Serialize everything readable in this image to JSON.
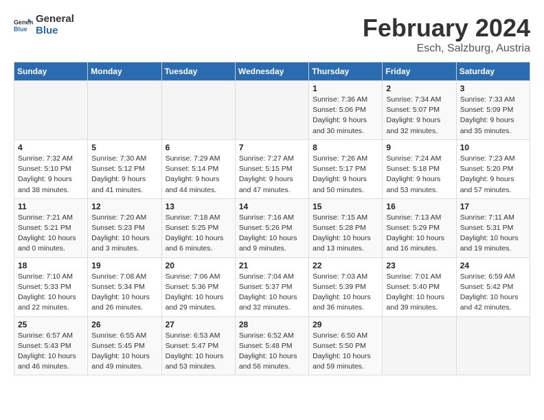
{
  "header": {
    "logo_line1": "General",
    "logo_line2": "Blue",
    "title": "February 2024",
    "subtitle": "Esch, Salzburg, Austria"
  },
  "days_of_week": [
    "Sunday",
    "Monday",
    "Tuesday",
    "Wednesday",
    "Thursday",
    "Friday",
    "Saturday"
  ],
  "weeks": [
    [
      {
        "day": "",
        "detail": ""
      },
      {
        "day": "",
        "detail": ""
      },
      {
        "day": "",
        "detail": ""
      },
      {
        "day": "",
        "detail": ""
      },
      {
        "day": "1",
        "detail": "Sunrise: 7:36 AM\nSunset: 5:06 PM\nDaylight: 9 hours and 30 minutes."
      },
      {
        "day": "2",
        "detail": "Sunrise: 7:34 AM\nSunset: 5:07 PM\nDaylight: 9 hours and 32 minutes."
      },
      {
        "day": "3",
        "detail": "Sunrise: 7:33 AM\nSunset: 5:09 PM\nDaylight: 9 hours and 35 minutes."
      }
    ],
    [
      {
        "day": "4",
        "detail": "Sunrise: 7:32 AM\nSunset: 5:10 PM\nDaylight: 9 hours and 38 minutes."
      },
      {
        "day": "5",
        "detail": "Sunrise: 7:30 AM\nSunset: 5:12 PM\nDaylight: 9 hours and 41 minutes."
      },
      {
        "day": "6",
        "detail": "Sunrise: 7:29 AM\nSunset: 5:14 PM\nDaylight: 9 hours and 44 minutes."
      },
      {
        "day": "7",
        "detail": "Sunrise: 7:27 AM\nSunset: 5:15 PM\nDaylight: 9 hours and 47 minutes."
      },
      {
        "day": "8",
        "detail": "Sunrise: 7:26 AM\nSunset: 5:17 PM\nDaylight: 9 hours and 50 minutes."
      },
      {
        "day": "9",
        "detail": "Sunrise: 7:24 AM\nSunset: 5:18 PM\nDaylight: 9 hours and 53 minutes."
      },
      {
        "day": "10",
        "detail": "Sunrise: 7:23 AM\nSunset: 5:20 PM\nDaylight: 9 hours and 57 minutes."
      }
    ],
    [
      {
        "day": "11",
        "detail": "Sunrise: 7:21 AM\nSunset: 5:21 PM\nDaylight: 10 hours and 0 minutes."
      },
      {
        "day": "12",
        "detail": "Sunrise: 7:20 AM\nSunset: 5:23 PM\nDaylight: 10 hours and 3 minutes."
      },
      {
        "day": "13",
        "detail": "Sunrise: 7:18 AM\nSunset: 5:25 PM\nDaylight: 10 hours and 6 minutes."
      },
      {
        "day": "14",
        "detail": "Sunrise: 7:16 AM\nSunset: 5:26 PM\nDaylight: 10 hours and 9 minutes."
      },
      {
        "day": "15",
        "detail": "Sunrise: 7:15 AM\nSunset: 5:28 PM\nDaylight: 10 hours and 13 minutes."
      },
      {
        "day": "16",
        "detail": "Sunrise: 7:13 AM\nSunset: 5:29 PM\nDaylight: 10 hours and 16 minutes."
      },
      {
        "day": "17",
        "detail": "Sunrise: 7:11 AM\nSunset: 5:31 PM\nDaylight: 10 hours and 19 minutes."
      }
    ],
    [
      {
        "day": "18",
        "detail": "Sunrise: 7:10 AM\nSunset: 5:33 PM\nDaylight: 10 hours and 22 minutes."
      },
      {
        "day": "19",
        "detail": "Sunrise: 7:08 AM\nSunset: 5:34 PM\nDaylight: 10 hours and 26 minutes."
      },
      {
        "day": "20",
        "detail": "Sunrise: 7:06 AM\nSunset: 5:36 PM\nDaylight: 10 hours and 29 minutes."
      },
      {
        "day": "21",
        "detail": "Sunrise: 7:04 AM\nSunset: 5:37 PM\nDaylight: 10 hours and 32 minutes."
      },
      {
        "day": "22",
        "detail": "Sunrise: 7:03 AM\nSunset: 5:39 PM\nDaylight: 10 hours and 36 minutes."
      },
      {
        "day": "23",
        "detail": "Sunrise: 7:01 AM\nSunset: 5:40 PM\nDaylight: 10 hours and 39 minutes."
      },
      {
        "day": "24",
        "detail": "Sunrise: 6:59 AM\nSunset: 5:42 PM\nDaylight: 10 hours and 42 minutes."
      }
    ],
    [
      {
        "day": "25",
        "detail": "Sunrise: 6:57 AM\nSunset: 5:43 PM\nDaylight: 10 hours and 46 minutes."
      },
      {
        "day": "26",
        "detail": "Sunrise: 6:55 AM\nSunset: 5:45 PM\nDaylight: 10 hours and 49 minutes."
      },
      {
        "day": "27",
        "detail": "Sunrise: 6:53 AM\nSunset: 5:47 PM\nDaylight: 10 hours and 53 minutes."
      },
      {
        "day": "28",
        "detail": "Sunrise: 6:52 AM\nSunset: 5:48 PM\nDaylight: 10 hours and 56 minutes."
      },
      {
        "day": "29",
        "detail": "Sunrise: 6:50 AM\nSunset: 5:50 PM\nDaylight: 10 hours and 59 minutes."
      },
      {
        "day": "",
        "detail": ""
      },
      {
        "day": "",
        "detail": ""
      }
    ]
  ]
}
